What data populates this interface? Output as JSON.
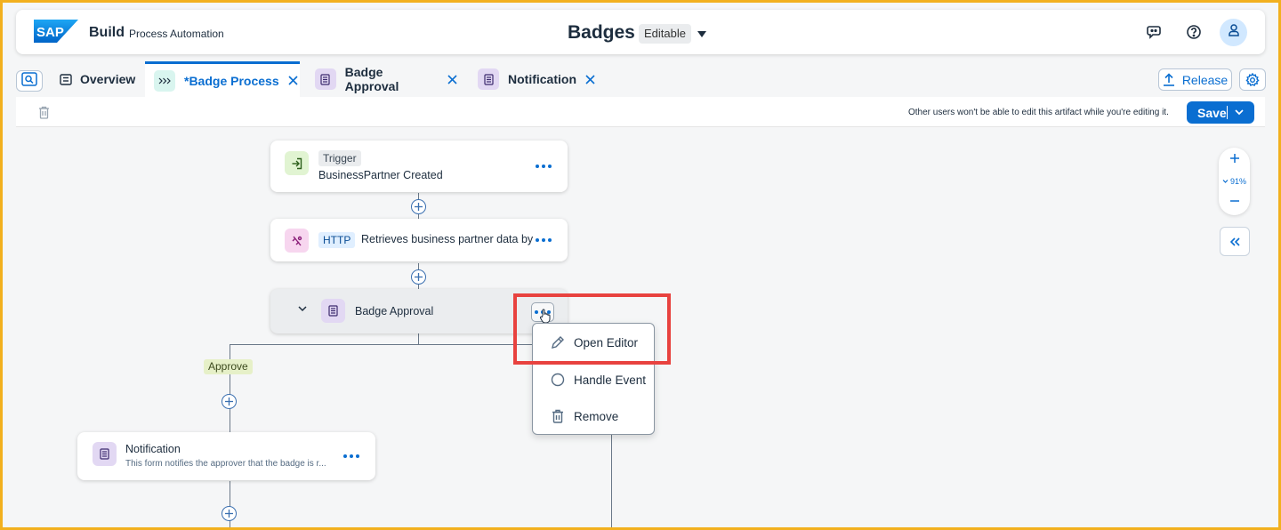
{
  "shell": {
    "logo": "SAP",
    "product": "Build",
    "subtitle": "Process Automation",
    "title": "Badges",
    "status": "Editable",
    "icons": [
      "feedback-icon",
      "help-icon",
      "user-icon"
    ]
  },
  "tabs": [
    {
      "label": "Overview",
      "icon": "document-list-icon",
      "closable": false,
      "active": false
    },
    {
      "label": "*Badge Process",
      "icon": "process-icon",
      "closable": true,
      "active": true
    },
    {
      "label": "Badge Approval",
      "icon": "form-icon",
      "closable": true,
      "active": false
    },
    {
      "label": "Notification",
      "icon": "form-icon",
      "closable": true,
      "active": false
    }
  ],
  "release_label": "Release",
  "toolbar": {
    "message": "Other users won't be able to edit this artifact while you're editing it.",
    "save_label": "Save"
  },
  "nodes": {
    "trigger": {
      "tag": "Trigger",
      "text": "BusinessPartner Created"
    },
    "http": {
      "tag": "HTTP",
      "text": "Retrieves business partner data by"
    },
    "approval": {
      "text": "Badge Approval"
    },
    "notification": {
      "title": "Notification",
      "desc": "This form notifies the approver that the badge is r..."
    }
  },
  "branch_label": "Approve",
  "zoom": {
    "level": "91%"
  },
  "context_menu": {
    "items": [
      {
        "label": "Open Editor",
        "icon": "pencil-icon"
      },
      {
        "label": "Handle Event",
        "icon": "circle-icon"
      },
      {
        "label": "Remove",
        "icon": "trash-icon"
      }
    ]
  },
  "colors": {
    "accent": "#0a6ed1",
    "highlight": "#e8423f",
    "frame": "#f2b01e"
  }
}
